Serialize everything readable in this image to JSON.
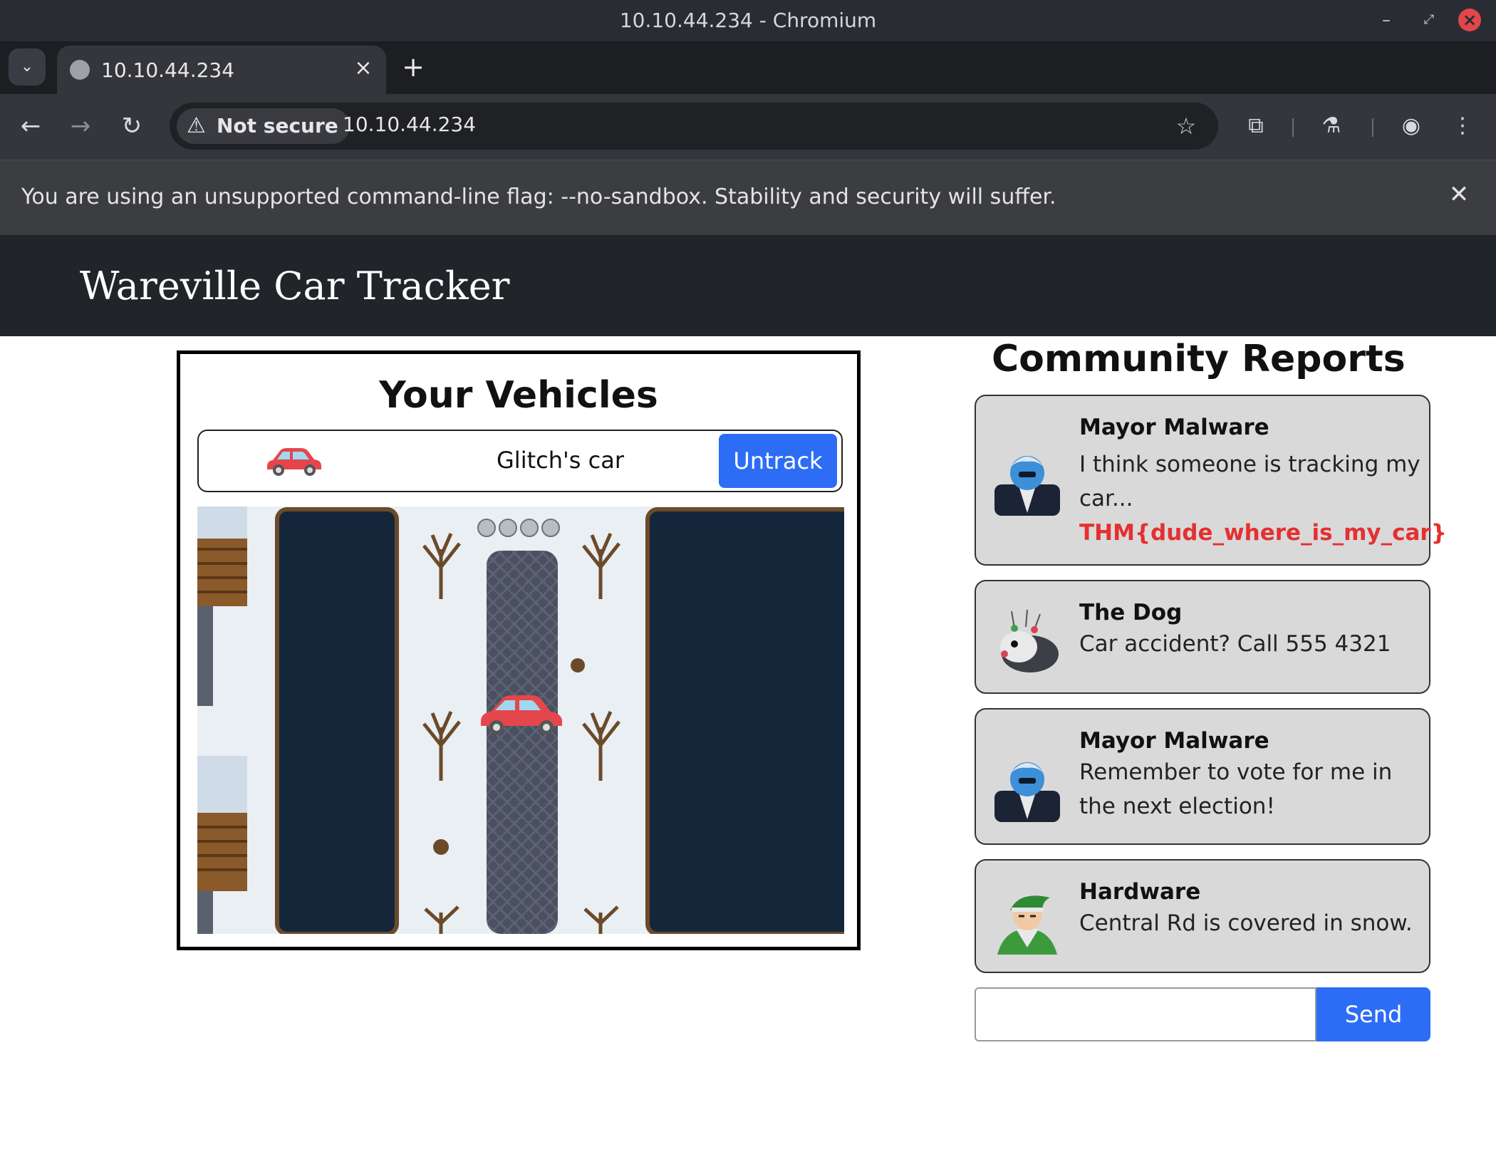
{
  "window": {
    "title": "10.10.44.234 - Chromium"
  },
  "tabs": [
    {
      "title": "10.10.44.234"
    }
  ],
  "address_bar": {
    "security_label": "Not secure",
    "url": "10.10.44.234"
  },
  "infobar": {
    "message": "You are using an unsupported command-line flag: --no-sandbox. Stability and security will suffer."
  },
  "site": {
    "brand": "Wareville Car Tracker"
  },
  "vehicles": {
    "heading": "Your Vehicles",
    "items": [
      {
        "name": "Glitch's car",
        "button": "Untrack",
        "icon": "car-icon"
      }
    ]
  },
  "reports": {
    "heading": "Community Reports",
    "items": [
      {
        "author": "Mayor Malware",
        "text": "I think someone is tracking my car...",
        "flag": "THM{dude_where_is_my_car}",
        "avatar": "mayor-malware-avatar"
      },
      {
        "author": "The Dog",
        "text": "Car accident? Call 555 4321",
        "avatar": "dog-avatar"
      },
      {
        "author": "Mayor Malware",
        "text": "Remember to vote for me in the next election!",
        "avatar": "mayor-malware-avatar"
      },
      {
        "author": "Hardware",
        "text": "Central Rd is covered in snow.",
        "avatar": "elf-avatar"
      }
    ]
  },
  "chat": {
    "input_value": "",
    "send_label": "Send"
  },
  "colors": {
    "accent": "#2d6df6",
    "flag": "#e53030",
    "header": "#212529",
    "water": "#14273a",
    "road": "#4a5060"
  }
}
